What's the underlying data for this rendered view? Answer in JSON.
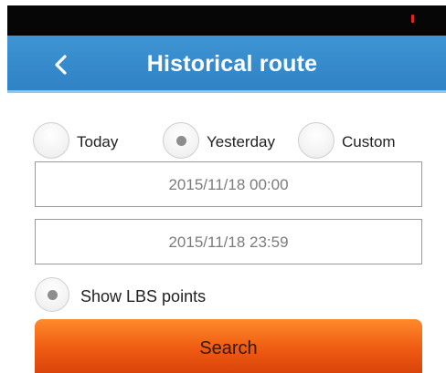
{
  "header": {
    "title": "Historical route",
    "back_icon": "chevron-left-icon"
  },
  "status_bar": {
    "battery_color": "#e0262a"
  },
  "date_range_options": {
    "selected": "Yesterday",
    "items": [
      {
        "label": "Today",
        "selected": false
      },
      {
        "label": "Yesterday",
        "selected": true
      },
      {
        "label": "Custom",
        "selected": false
      }
    ]
  },
  "start_time": {
    "value": "2015/11/18 00:00"
  },
  "end_time": {
    "value": "2015/11/18 23:59"
  },
  "lbs_option": {
    "label": "Show LBS points",
    "selected": true
  },
  "search_button": {
    "label": "Search"
  },
  "colors": {
    "header": "#3f94d3",
    "button": "#ef5b12"
  }
}
